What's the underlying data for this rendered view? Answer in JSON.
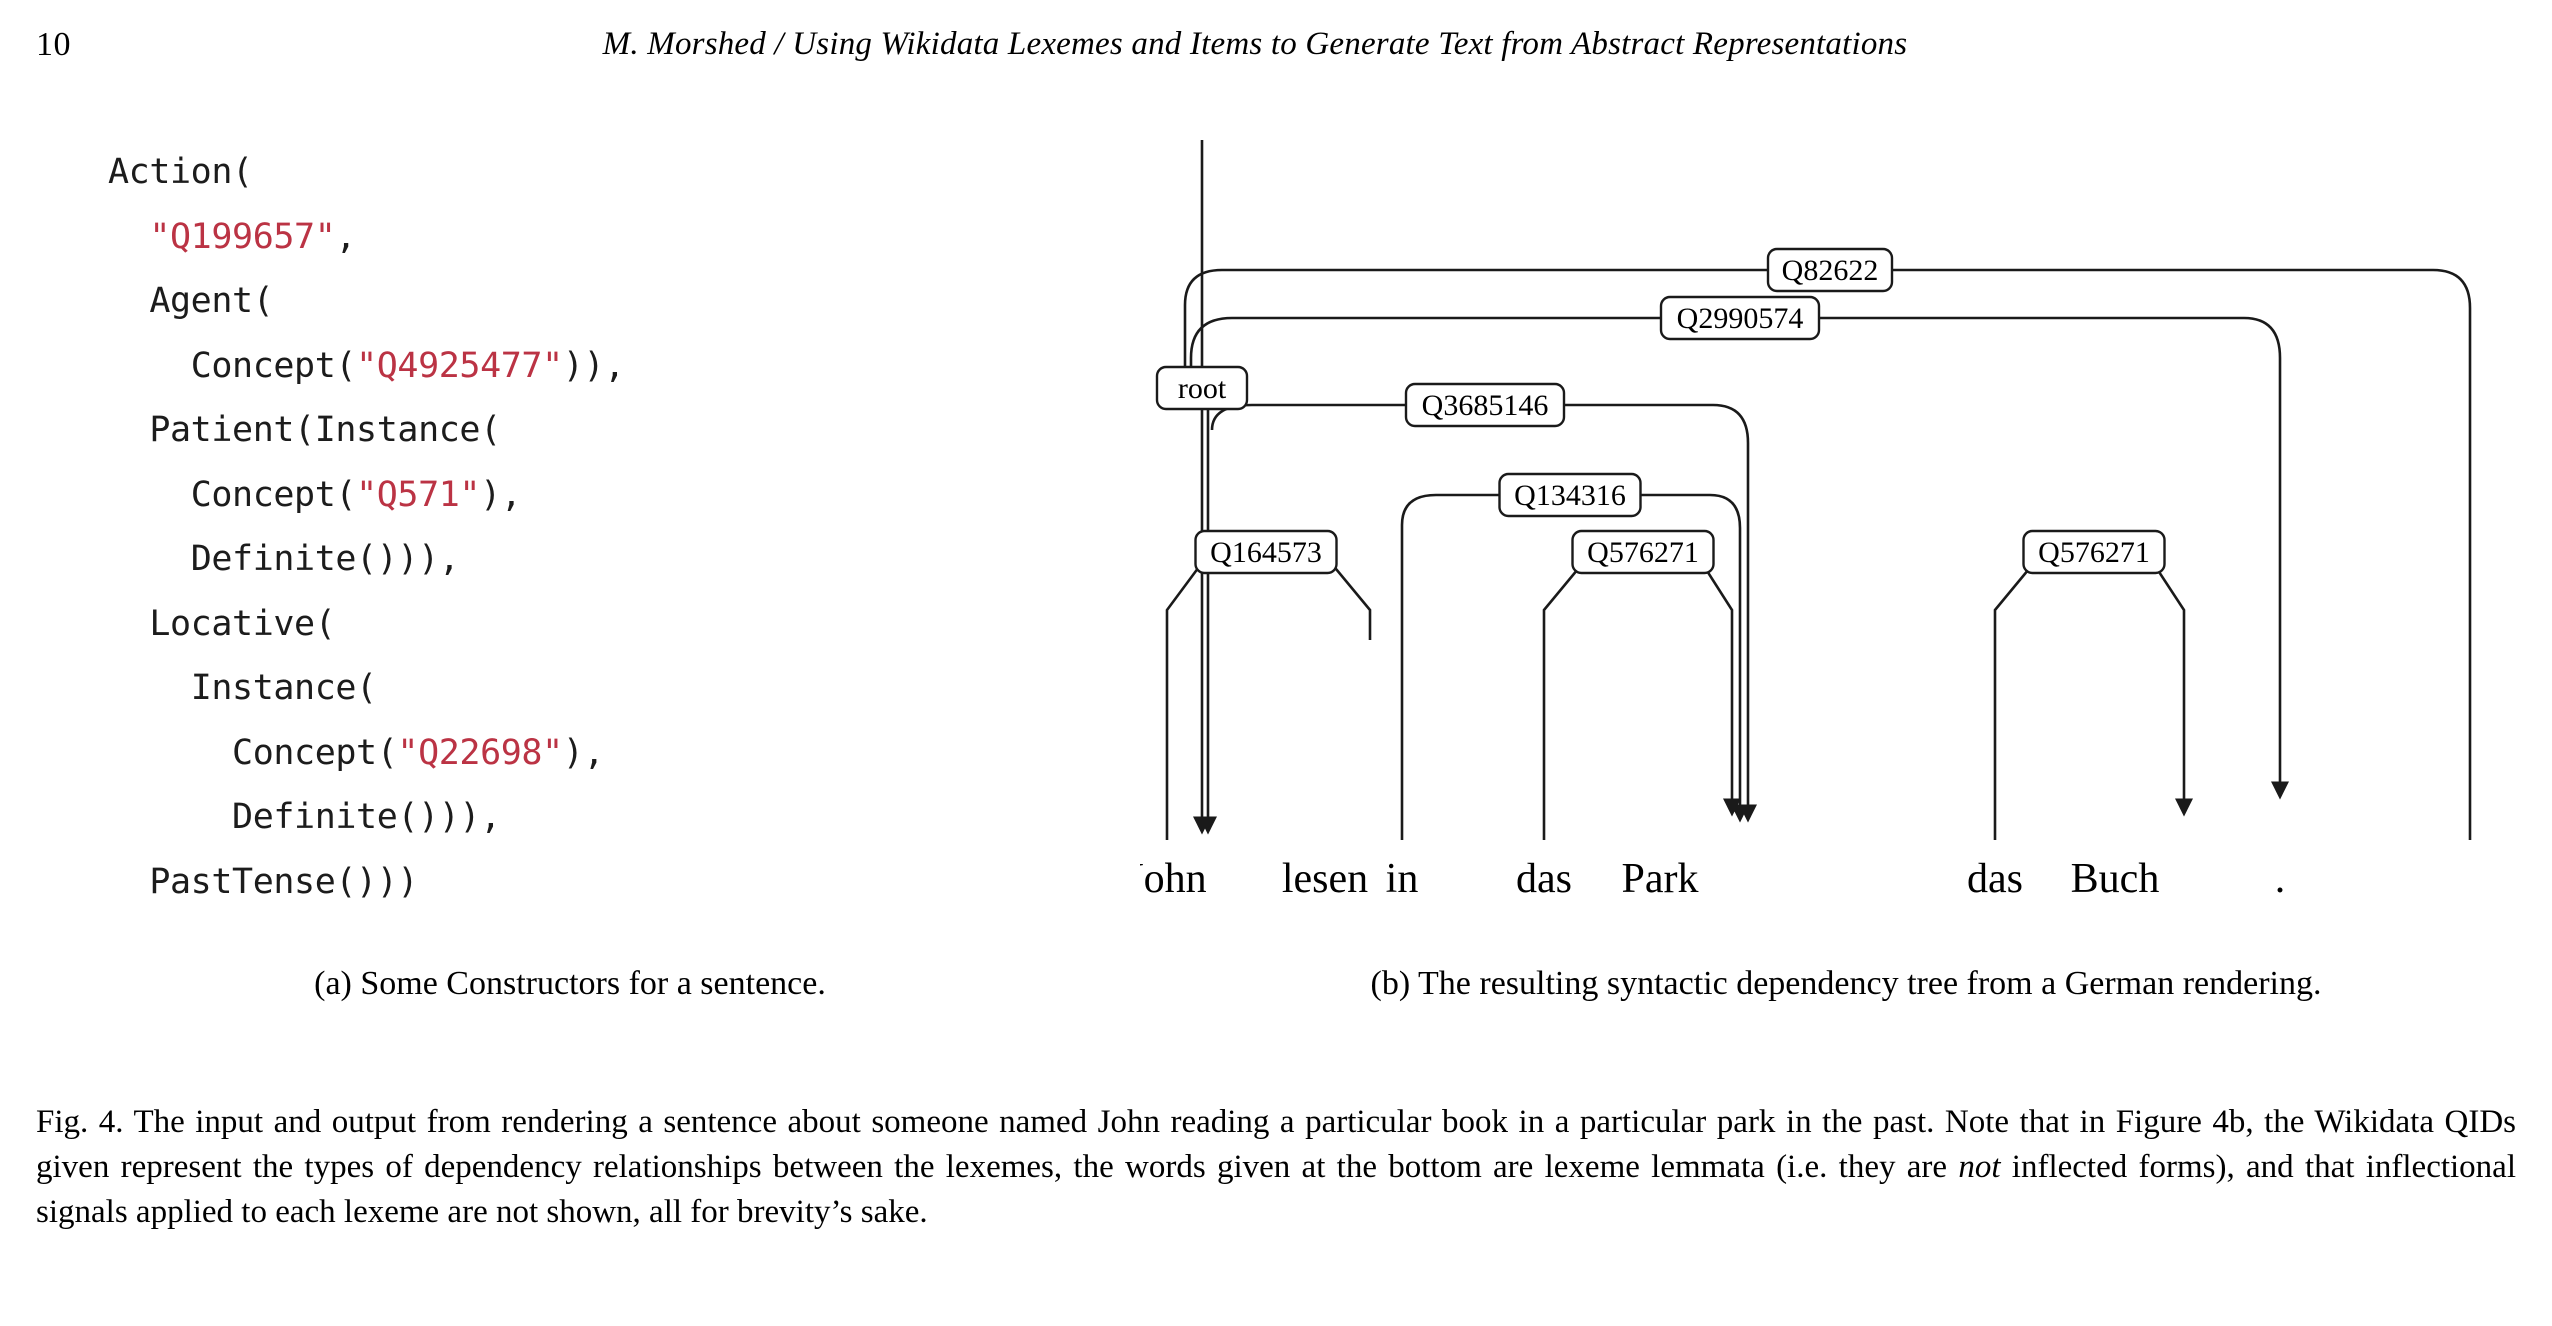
{
  "running_head": {
    "page_number": "10",
    "title": "M. Morshed / Using Wikidata Lexemes and Items to Generate Text from Abstract Representations"
  },
  "subfigure_a": {
    "caption": "(a) Some Constructors for a sentence.",
    "code_lines": [
      {
        "indent": 0,
        "segments": [
          {
            "text": "Action(",
            "kind": "plain"
          }
        ]
      },
      {
        "indent": 1,
        "segments": [
          {
            "text": "\"Q199657\"",
            "kind": "qid"
          },
          {
            "text": ",",
            "kind": "plain"
          }
        ]
      },
      {
        "indent": 1,
        "segments": [
          {
            "text": "Agent(",
            "kind": "plain"
          }
        ]
      },
      {
        "indent": 2,
        "segments": [
          {
            "text": "Concept(",
            "kind": "plain"
          },
          {
            "text": "\"Q4925477\"",
            "kind": "qid"
          },
          {
            "text": ")),",
            "kind": "plain"
          }
        ]
      },
      {
        "indent": 1,
        "segments": [
          {
            "text": "Patient(Instance(",
            "kind": "plain"
          }
        ]
      },
      {
        "indent": 2,
        "segments": [
          {
            "text": "Concept(",
            "kind": "plain"
          },
          {
            "text": "\"Q571\"",
            "kind": "qid"
          },
          {
            "text": "),",
            "kind": "plain"
          }
        ]
      },
      {
        "indent": 2,
        "segments": [
          {
            "text": "Definite())),",
            "kind": "plain"
          }
        ]
      },
      {
        "indent": 1,
        "segments": [
          {
            "text": "Locative(",
            "kind": "plain"
          }
        ]
      },
      {
        "indent": 2,
        "segments": [
          {
            "text": "Instance(",
            "kind": "plain"
          }
        ]
      },
      {
        "indent": 3,
        "segments": [
          {
            "text": "Concept(",
            "kind": "plain"
          },
          {
            "text": "\"Q22698\"",
            "kind": "qid"
          },
          {
            "text": "),",
            "kind": "plain"
          }
        ]
      },
      {
        "indent": 3,
        "segments": [
          {
            "text": "Definite())),",
            "kind": "plain"
          }
        ]
      },
      {
        "indent": 1,
        "segments": [
          {
            "text": "PastTense()))",
            "kind": "plain"
          }
        ]
      }
    ],
    "qid_color": "#bb3344",
    "text_color": "#1c1c1c"
  },
  "subfigure_b": {
    "caption": "(b) The resulting syntactic dependency tree from a German rendering.",
    "words": [
      "John",
      "lesen",
      "in",
      "das",
      "Park",
      "das",
      "Buch",
      "."
    ],
    "root_label": "root",
    "relation_labels": [
      "Q82622",
      "Q2990574",
      "Q3685146",
      "Q134316",
      "Q576271",
      "Q576271",
      "Q164573"
    ],
    "edges": [
      {
        "label": "Q82622",
        "from": "root",
        "to": "."
      },
      {
        "label": "Q2990574",
        "from": "root",
        "to": "Buch"
      },
      {
        "label": "Q3685146",
        "from": "lesen",
        "to": "Park"
      },
      {
        "label": "Q134316",
        "from": "in",
        "to": "Park"
      },
      {
        "label": "Q576271",
        "from": "das",
        "to": "Park"
      },
      {
        "label": "Q576271",
        "from": "das",
        "to": "Buch"
      },
      {
        "label": "Q164573",
        "from": "John",
        "to": "lesen"
      },
      {
        "label": "root",
        "from": "root",
        "to": "lesen"
      }
    ],
    "stroke_color": "#1a1a1a"
  },
  "figure_caption": {
    "parts": [
      {
        "text": "Fig. 4. The input and output from rendering a sentence about someone named John reading a particular book in a particular park in the past. Note that in Figure 4b, the Wikidata QIDs given represent the types of dependency relationships between the lexemes, the words given at the bottom are lexeme lemmata (i.e. they are ",
        "style": "roman"
      },
      {
        "text": "not",
        "style": "italic"
      },
      {
        "text": " inflected forms), and that inflectional signals applied to each lexeme are not shown, all for brevity’s sake.",
        "style": "roman"
      }
    ]
  }
}
